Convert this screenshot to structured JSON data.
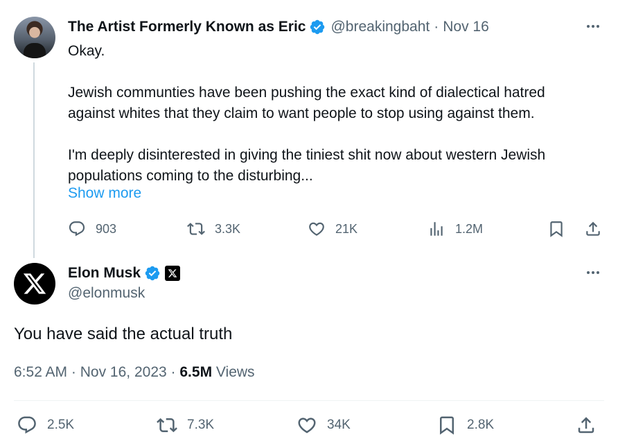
{
  "parent_tweet": {
    "author_name": "The Artist Formerly Known as Eric",
    "handle": "@breakingbaht",
    "separator": "·",
    "date": "Nov 16",
    "text_lines": [
      "Okay.",
      "Jewish communties have been pushing the exact kind of dialectical hatred",
      "against whites that they claim to want people to stop using against them.",
      "I'm deeply disinterested in giving the tiniest shit now about western Jewish",
      "populations coming to the disturbing..."
    ],
    "show_more": "Show more",
    "replies": "903",
    "reposts": "3.3K",
    "likes": "21K",
    "views": "1.2M"
  },
  "main_tweet": {
    "author_name": "Elon Musk",
    "handle": "@elonmusk",
    "text": "You have said the actual truth",
    "time": "6:52 AM",
    "sep1": "·",
    "date": "Nov 16, 2023",
    "sep2": "·",
    "views_count": "6.5M",
    "views_label": "Views",
    "replies": "2.5K",
    "reposts": "7.3K",
    "likes": "34K",
    "bookmarks": "2.8K"
  },
  "colors": {
    "accent": "#1d9bf0",
    "secondary_text": "#536471",
    "primary_text": "#0f1419",
    "thread_line": "#cfd9de"
  },
  "icons": {
    "verified": "verified-badge-icon",
    "more": "more-dots-icon",
    "reply": "reply-icon",
    "repost": "repost-icon",
    "like": "heart-icon",
    "views": "views-chart-icon",
    "bookmark": "bookmark-icon",
    "share": "share-icon",
    "x_logo": "x-logo-icon"
  }
}
